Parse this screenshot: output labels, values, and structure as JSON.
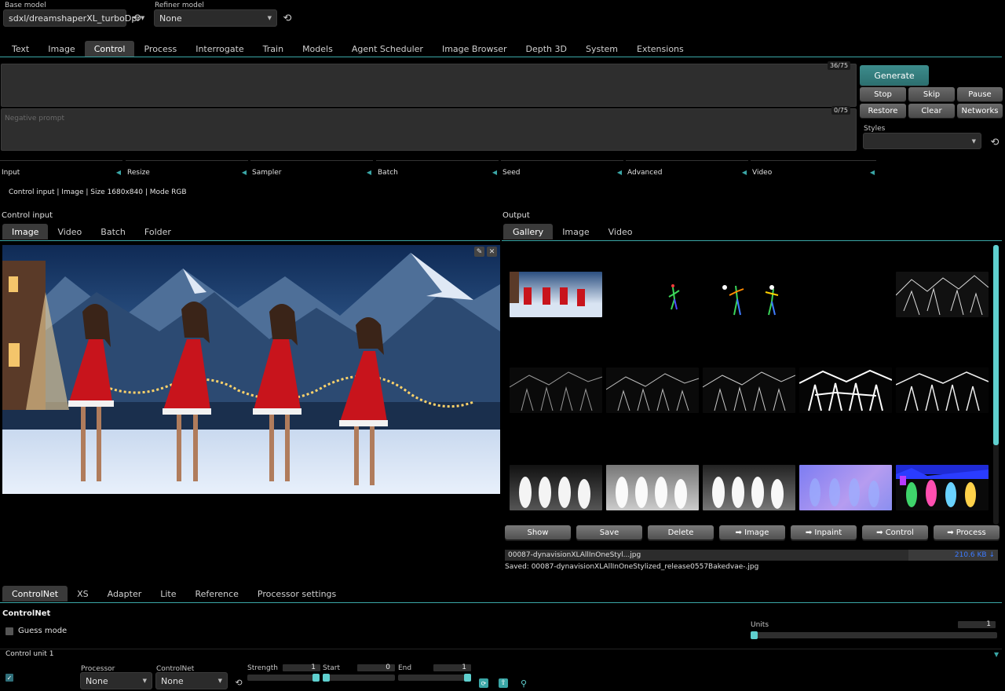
{
  "top": {
    "base_model_label": "Base model",
    "base_model_value": "sdxl/dreamshaperXL_turboDpr",
    "refiner_model_label": "Refiner model",
    "refiner_model_value": "None"
  },
  "tabs": [
    "Text",
    "Image",
    "Control",
    "Process",
    "Interrogate",
    "Train",
    "Models",
    "Agent Scheduler",
    "Image Browser",
    "Depth 3D",
    "System",
    "Extensions"
  ],
  "active_tab": "Control",
  "prompt": {
    "positive_counter": "36/75",
    "negative_placeholder": "Negative prompt",
    "negative_counter": "0/75"
  },
  "actions": {
    "generate": "Generate",
    "stop": "Stop",
    "skip": "Skip",
    "pause": "Pause",
    "restore": "Restore",
    "clear": "Clear",
    "networks": "Networks",
    "styles_label": "Styles"
  },
  "accordions": [
    "Input",
    "Resize",
    "Sampler",
    "Batch",
    "Seed",
    "Advanced",
    "Video"
  ],
  "info_line": "Control input | Image | Size 1680x840 | Mode RGB",
  "control_input": {
    "title": "Control input",
    "tabs": [
      "Image",
      "Video",
      "Batch",
      "Folder"
    ]
  },
  "output": {
    "title": "Output",
    "tabs": [
      "Gallery",
      "Image",
      "Video"
    ],
    "buttons": [
      "Show",
      "Save",
      "Delete",
      "➡ Image",
      "➡ Inpaint",
      "➡ Control",
      "➡ Process"
    ],
    "file_name": "00087-dynavisionXLAllInOneStyl...jpg",
    "file_size": "210.6 KB ↓",
    "saved_text": "Saved: 00087-dynavisionXLAllInOneStylized_release0557Bakedvae-.jpg"
  },
  "bottom": {
    "tabs": [
      "ControlNet",
      "XS",
      "Adapter",
      "Lite",
      "Reference",
      "Processor settings"
    ],
    "section_title": "ControlNet",
    "guess_mode": "Guess mode",
    "units_label": "Units",
    "units_value": "1",
    "unit_title": "Control unit 1",
    "processor_label": "Processor",
    "processor_value": "None",
    "controlnet_label": "ControlNet",
    "controlnet_value": "None",
    "strength_label": "Strength",
    "strength_value": "1",
    "start_label": "Start",
    "start_value": "0",
    "end_label": "End",
    "end_value": "1"
  },
  "colors": {
    "accent": "#3aa6a6",
    "panel": "#2e2e2e",
    "background": "#000000"
  },
  "icons": [
    "refresh-icon",
    "chevron-down-icon",
    "edit-icon",
    "close-icon",
    "checkbox-icon",
    "reset-icon",
    "upload-icon",
    "magnifier-icon"
  ]
}
